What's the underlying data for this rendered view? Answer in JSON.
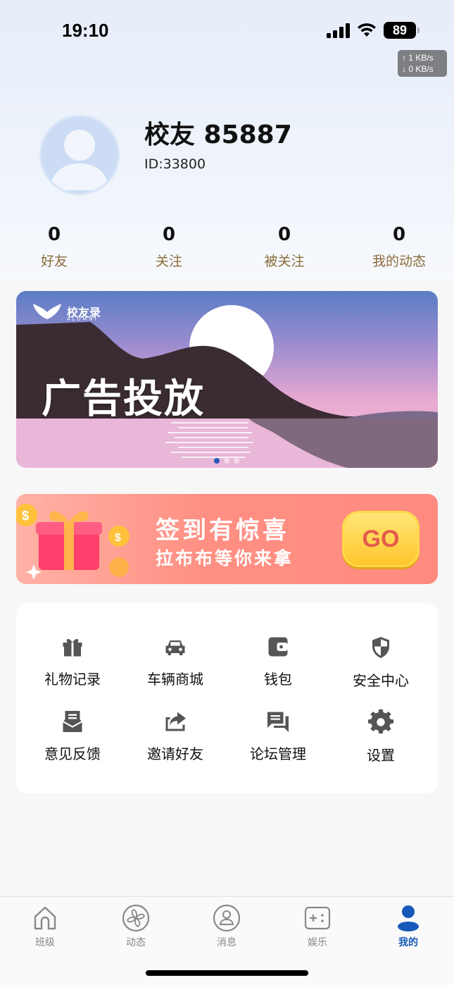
{
  "status_bar": {
    "time": "19:10",
    "battery": "89",
    "net_up": "↑ 1 KB/s",
    "net_down": "↓ 0 KB/s"
  },
  "profile": {
    "name": "校友 85887",
    "id": "ID:33800"
  },
  "stats": [
    {
      "value": "0",
      "label": "好友"
    },
    {
      "value": "0",
      "label": "关注"
    },
    {
      "value": "0",
      "label": "被关注"
    },
    {
      "value": "0",
      "label": "我的动态"
    }
  ],
  "banner": {
    "title": "广告投放",
    "logo_name": "校友录",
    "logo_sub": "ALUMNI"
  },
  "signin": {
    "title": "签到有惊喜",
    "subtitle": "拉布布等你来拿",
    "go_label": "GO"
  },
  "menu": [
    {
      "label": "礼物记录",
      "icon": "gift-icon"
    },
    {
      "label": "车辆商城",
      "icon": "car-icon"
    },
    {
      "label": "钱包",
      "icon": "wallet-icon"
    },
    {
      "label": "安全中心",
      "icon": "shield-icon"
    },
    {
      "label": "意见反馈",
      "icon": "feedback-icon"
    },
    {
      "label": "邀请好友",
      "icon": "share-icon"
    },
    {
      "label": "论坛管理",
      "icon": "forum-icon"
    },
    {
      "label": "设置",
      "icon": "gear-icon"
    }
  ],
  "tabs": [
    {
      "label": "班级",
      "icon": "home-icon"
    },
    {
      "label": "动态",
      "icon": "pinwheel-icon"
    },
    {
      "label": "消息",
      "icon": "message-icon"
    },
    {
      "label": "娱乐",
      "icon": "game-icon"
    },
    {
      "label": "我的",
      "icon": "person-icon",
      "active": true
    }
  ],
  "colors": {
    "accent": "#1759b8",
    "stat_label": "#8b6b3b",
    "signin_bg": "#ff8f83",
    "go_text": "#e45b4c"
  }
}
